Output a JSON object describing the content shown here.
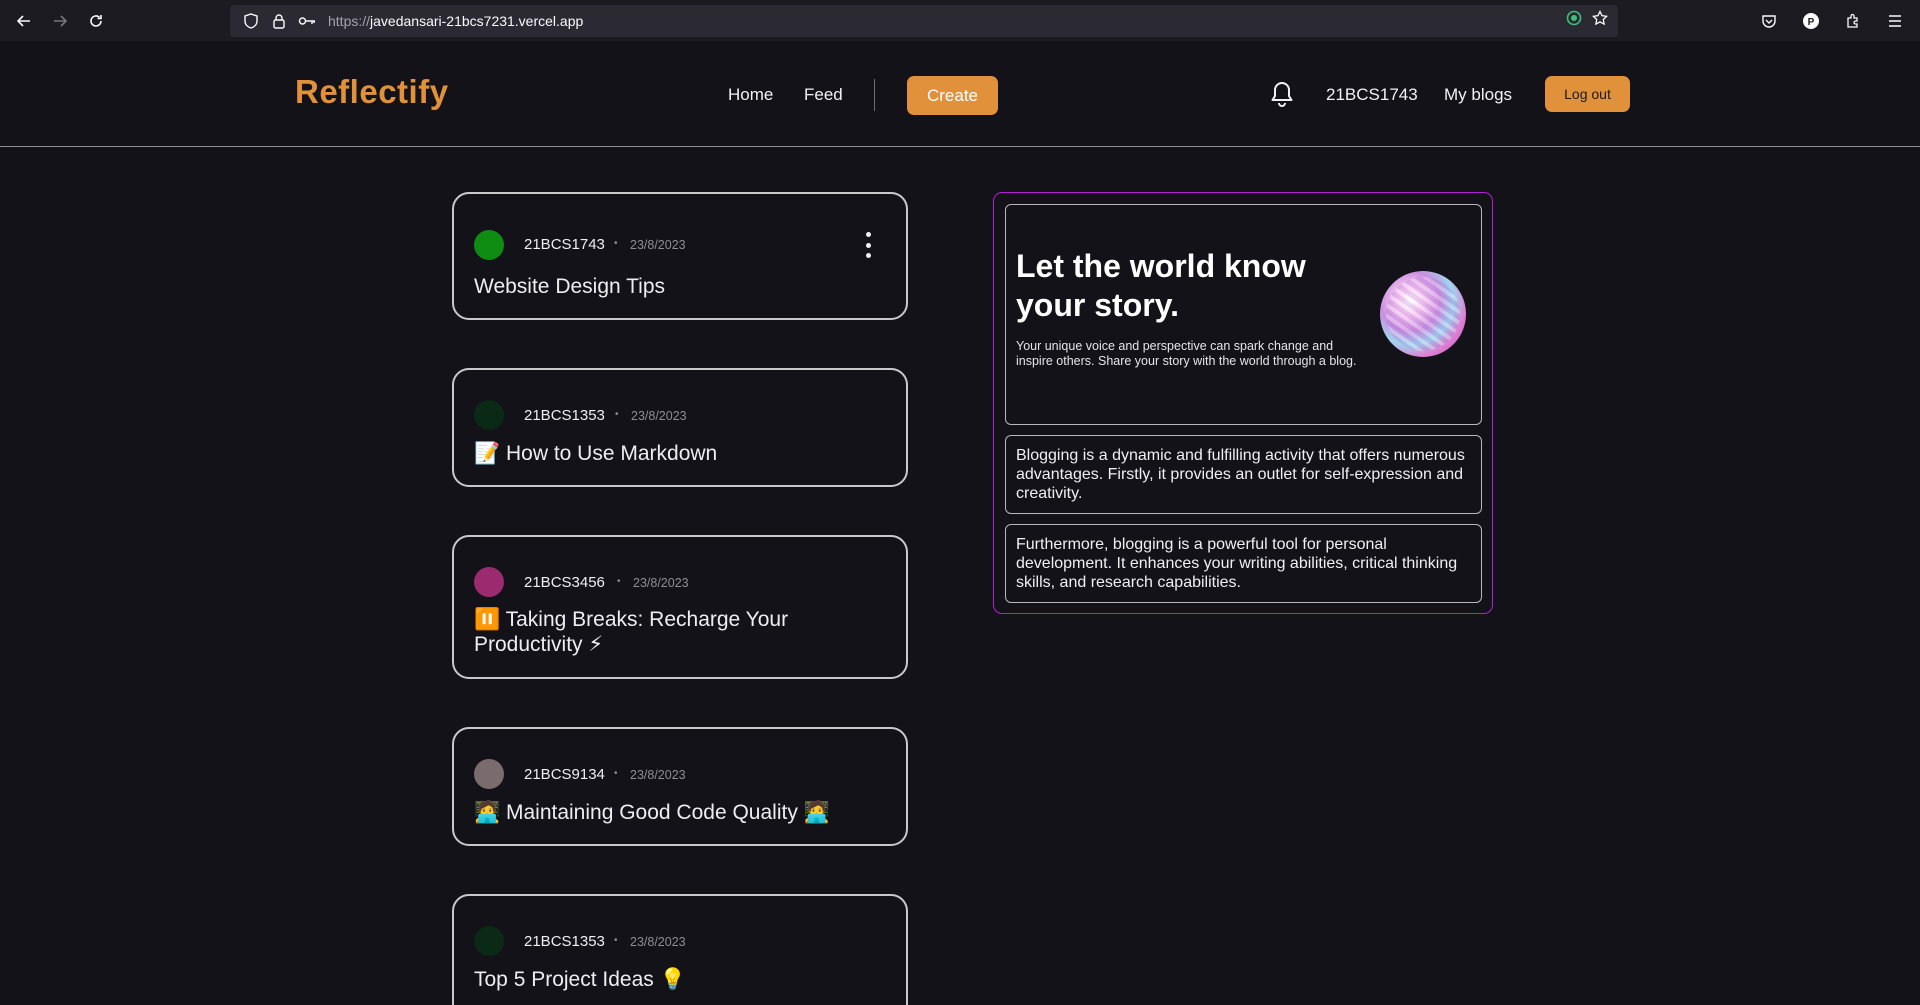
{
  "browser": {
    "url_protocol": "https://",
    "url_host": "javedansari-21bcs7231.vercel.app"
  },
  "header": {
    "logo": "Reflectify",
    "nav": {
      "home": "Home",
      "feed": "Feed"
    },
    "create_label": "Create",
    "username": "21BCS1743",
    "my_blogs": "My blogs",
    "logout_label": "Log out"
  },
  "posts": [
    {
      "author": "21BCS1743",
      "date": "23/8/2023",
      "title": "Website Design Tips",
      "avatar_color": "#0f8c12",
      "has_menu": true
    },
    {
      "author": "21BCS1353",
      "date": "23/8/2023",
      "title": "📝 How to Use Markdown",
      "avatar_color": "#0b2a16"
    },
    {
      "author": "21BCS3456",
      "date": "23/8/2023",
      "title": "⏸️ Taking Breaks: Recharge Your Productivity ⚡",
      "avatar_color": "#9c2a6e"
    },
    {
      "author": "21BCS9134",
      "date": "23/8/2023",
      "title": "🧑‍💻 Maintaining Good Code Quality 🧑‍💻",
      "avatar_color": "#7a6b6e"
    },
    {
      "author": "21BCS1353",
      "date": "23/8/2023",
      "title": "Top 5 Project Ideas 💡",
      "avatar_color": "#0b2a16"
    }
  ],
  "side_panel": {
    "hero_title": "Let the world know your story.",
    "hero_desc": "Your unique voice and perspective can spark change and inspire others. Share your story with the world through a blog.",
    "paragraph_1": "Blogging is a dynamic and fulfilling activity that offers numerous advantages. Firstly, it provides an outlet for self-expression and creativity.",
    "paragraph_2": "Furthermore, blogging is a powerful tool for personal development. It enhances your writing abilities, critical thinking skills, and research capabilities."
  },
  "colors": {
    "accent": "#e0913a",
    "panel_border": "#b21fd8"
  }
}
